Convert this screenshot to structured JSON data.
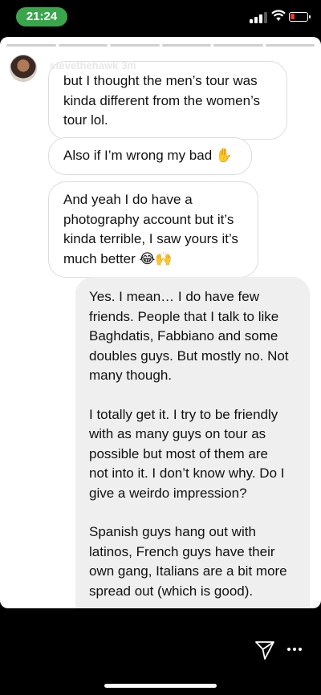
{
  "status_bar": {
    "time": "21:24",
    "time_pill_color": "#3aa64c",
    "battery_color": "#e23b2c"
  },
  "story": {
    "username": "stevethehawk",
    "time_ago": "3m",
    "progress_segments": 6,
    "close_icon": "close-icon"
  },
  "messages": {
    "incoming": [
      {
        "lines": [
          "but I thought the men’s tour was",
          "kinda different from the women’s",
          "tour lol."
        ]
      },
      {
        "lines": [
          "Also if I’m wrong my bad ✋"
        ]
      },
      {
        "lines": [
          "And yeah I do have a",
          "photography account but it’s",
          "kinda terrible, I saw yours it’s",
          "much better 😂🙌"
        ]
      }
    ],
    "outgoing": [
      {
        "lines": [
          "Yes. I mean… I do have few",
          "friends. People that I talk to like",
          "Baghdatis, Fabbiano and some",
          "doubles guys. But mostly no. Not",
          "many though."
        ]
      },
      {
        "lines": [
          "I totally get it. I try to be friendly",
          "with as many guys on tour as",
          "possible but most of them are",
          "not into it. I don’t know why. Do I",
          "give a weirdo impression?"
        ]
      },
      {
        "lines": [
          "Spanish guys hang out with",
          "latinos, French guys have their",
          "own gang, Italians are a bit more",
          "spread out (which is good)."
        ]
      }
    ]
  },
  "bottom_bar": {
    "send_icon": "paper-plane-icon",
    "more_icon": "more-horizontal-icon"
  }
}
